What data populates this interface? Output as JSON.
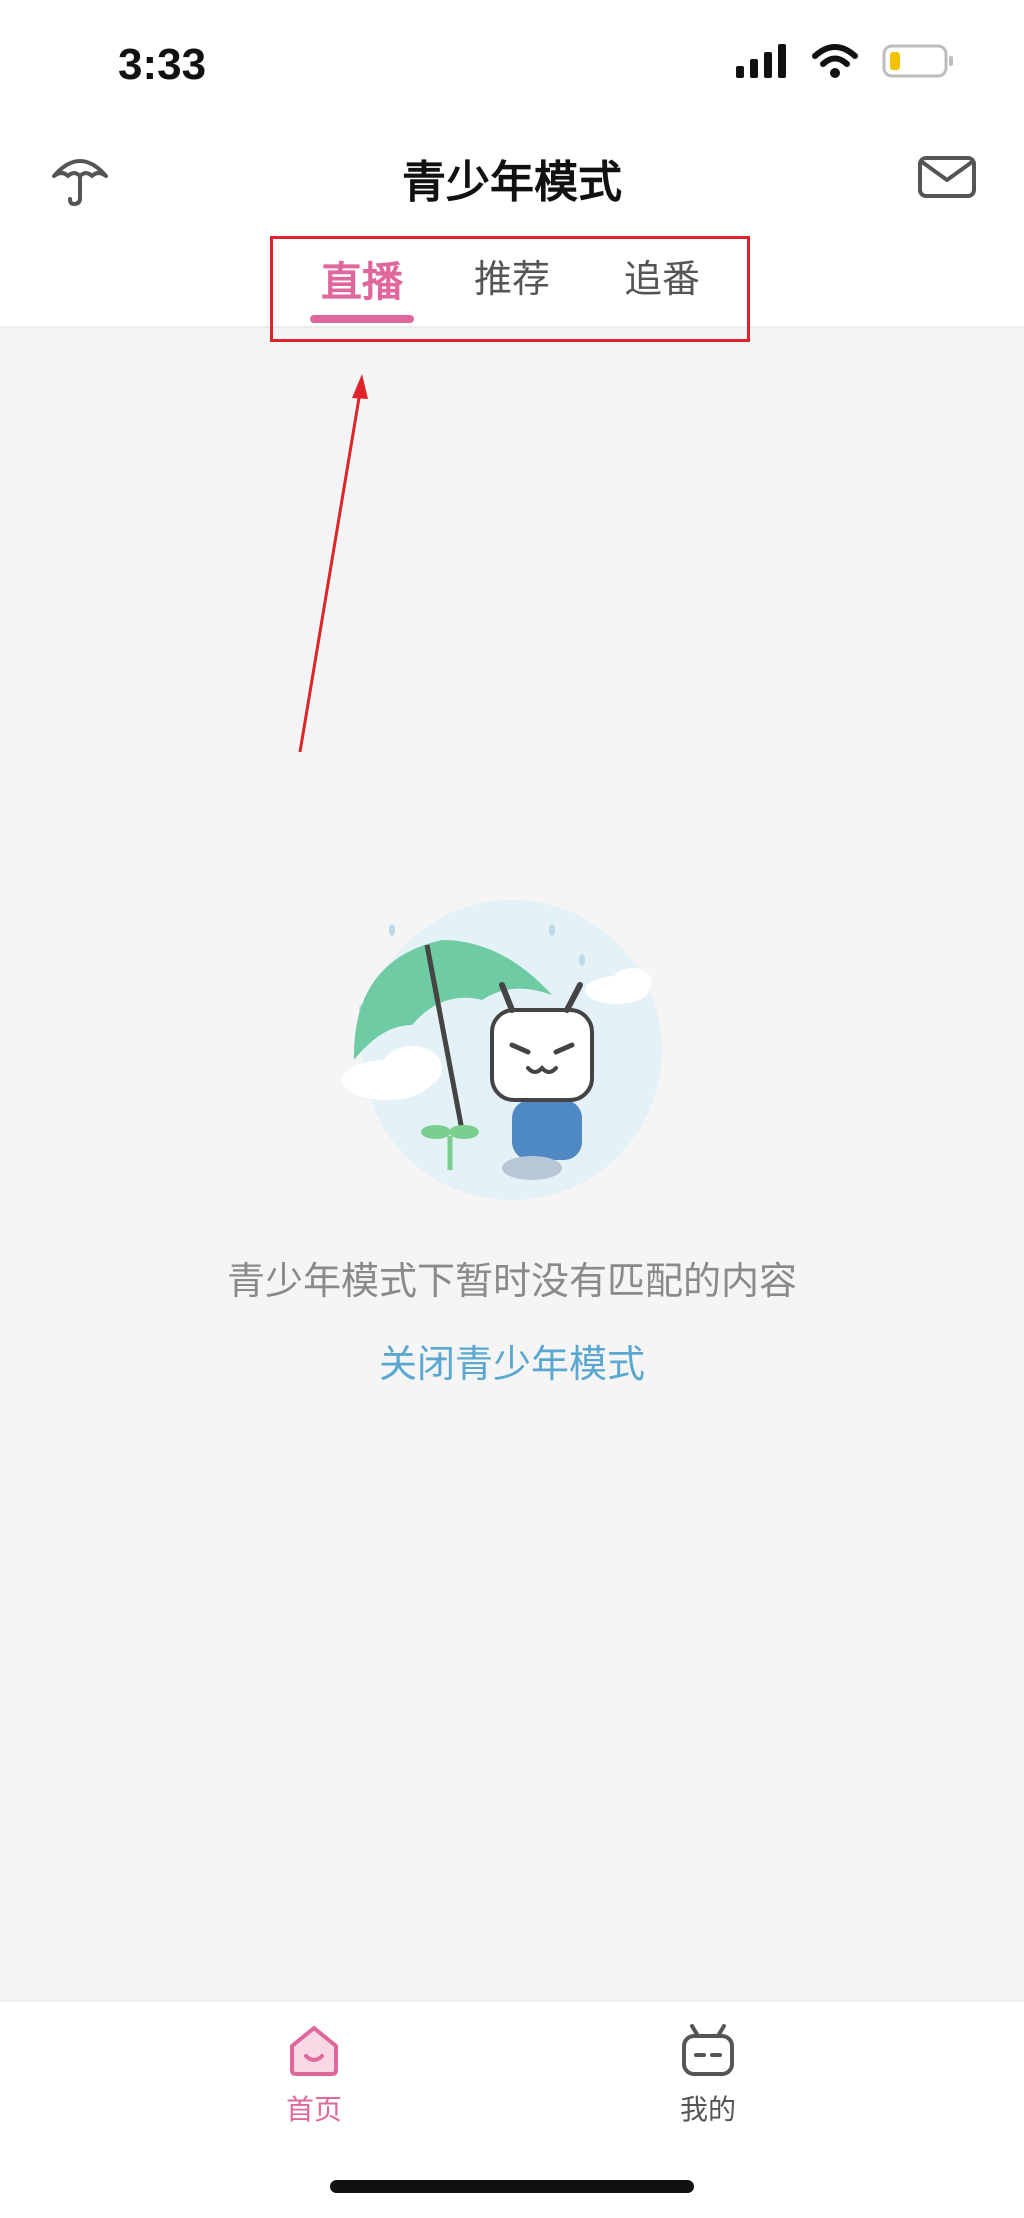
{
  "status_bar": {
    "time": "3:33"
  },
  "header": {
    "title": "青少年模式"
  },
  "tabs": [
    {
      "label": "直播",
      "active": true
    },
    {
      "label": "推荐",
      "active": false
    },
    {
      "label": "追番",
      "active": false
    }
  ],
  "empty_state": {
    "message": "青少年模式下暂时没有匹配的内容",
    "close_link": "关闭青少年模式"
  },
  "bottom_nav": [
    {
      "label": "首页",
      "icon": "home-icon",
      "active": true
    },
    {
      "label": "我的",
      "icon": "tv-mascot-icon",
      "active": false
    }
  ],
  "colors": {
    "accent": "#e0679b",
    "link": "#5aa7d0",
    "annotation": "#e0232b",
    "background": "#f5f5f5"
  }
}
